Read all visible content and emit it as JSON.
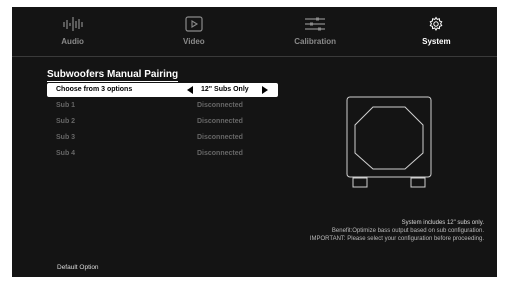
{
  "tabs": [
    {
      "label": "Audio",
      "icon": "audio-waveform-icon",
      "active": false
    },
    {
      "label": "Video",
      "icon": "play-icon",
      "active": false
    },
    {
      "label": "Calibration",
      "icon": "sliders-icon",
      "active": false
    },
    {
      "label": "System",
      "icon": "gear-icon",
      "active": true
    }
  ],
  "section": {
    "title": "Subwoofers Manual Pairing"
  },
  "options": {
    "label": "Choose from 3 options",
    "value": "12\" Subs Only"
  },
  "subs": [
    {
      "label": "Sub 1",
      "status": "Disconnected"
    },
    {
      "label": "Sub 2",
      "status": "Disconnected"
    },
    {
      "label": "Sub 3",
      "status": "Disconnected"
    },
    {
      "label": "Sub 4",
      "status": "Disconnected"
    }
  ],
  "info": {
    "line1": "System includes 12\" subs only.",
    "line2": "Benefit:Optimize bass output based on sub configuration.",
    "line3": "IMPORTANT: Please select your configuration before proceeding."
  },
  "footer": {
    "label": "Default Option"
  },
  "colors": {
    "background": "#141414",
    "highlight": "#ffffff",
    "disabled_text": "#666666"
  }
}
